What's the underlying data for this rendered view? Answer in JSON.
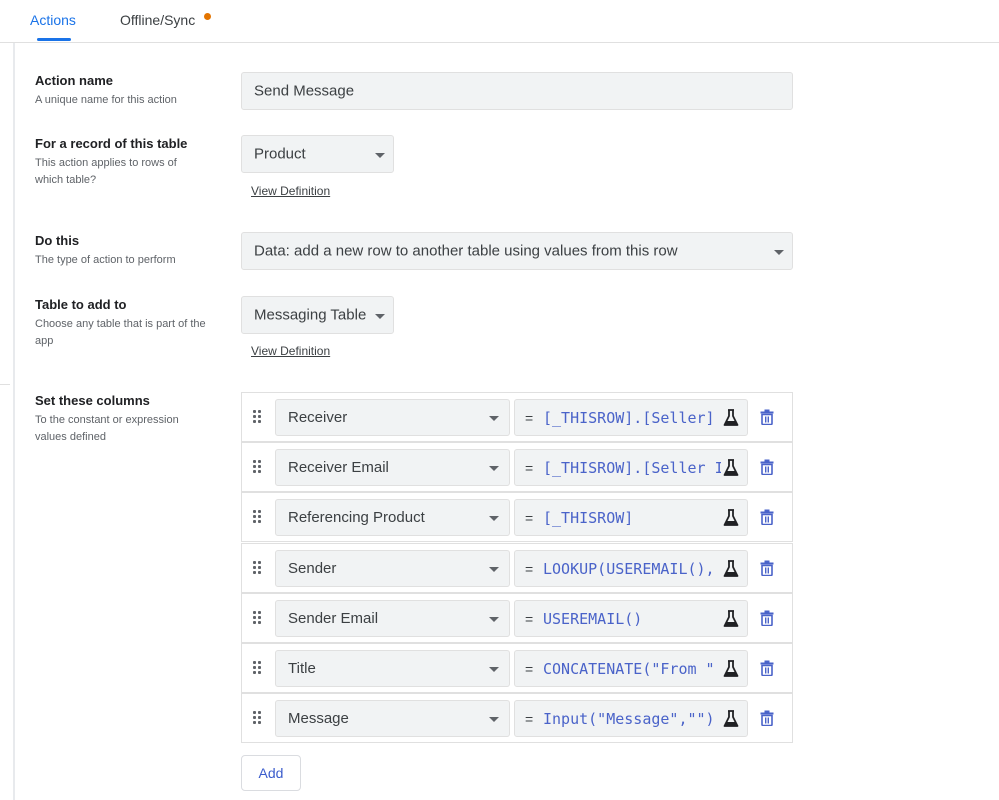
{
  "tabs": [
    {
      "label": "Actions",
      "active": true
    },
    {
      "label": "Offline/Sync",
      "has_dot": true
    }
  ],
  "colors": {
    "accent": "#1a73e8",
    "dot": "#e37400",
    "expression": "#4a63c9"
  },
  "action_name": {
    "title": "Action name",
    "desc": "A unique name for this action",
    "value": "Send Message"
  },
  "record_table": {
    "title": "For a record of this table",
    "desc": "This action applies to rows of which table?",
    "value": "Product",
    "link": "View Definition"
  },
  "do_this": {
    "title": "Do this",
    "desc": "The type of action to perform",
    "value": "Data: add a new row to another table using values from this row"
  },
  "table_to_add": {
    "title": "Table to add to",
    "desc": "Choose any table that is part of the app",
    "value": "Messaging Table",
    "link": "View Definition"
  },
  "set_columns": {
    "title": "Set these columns",
    "desc": "To the constant or expression values defined",
    "rows": [
      {
        "column": "Receiver",
        "expression": "[_THISROW].[Seller]"
      },
      {
        "column": "Receiver Email",
        "expression": "[_THISROW].[Seller I"
      },
      {
        "column": "Referencing Product",
        "expression": "[_THISROW]"
      },
      {
        "column": "Sender",
        "expression": "LOOKUP(USEREMAIL(),"
      },
      {
        "column": "Sender Email",
        "expression": "USEREMAIL()"
      },
      {
        "column": "Title",
        "expression": "CONCATENATE(\"From \""
      },
      {
        "column": "Message",
        "expression": "Input(\"Message\",\"\")"
      }
    ],
    "add_label": "Add",
    "equals_sign": "=",
    "icons": {
      "drag": "drag-handle-icon",
      "test": "flask-icon",
      "delete": "trash-icon"
    }
  }
}
